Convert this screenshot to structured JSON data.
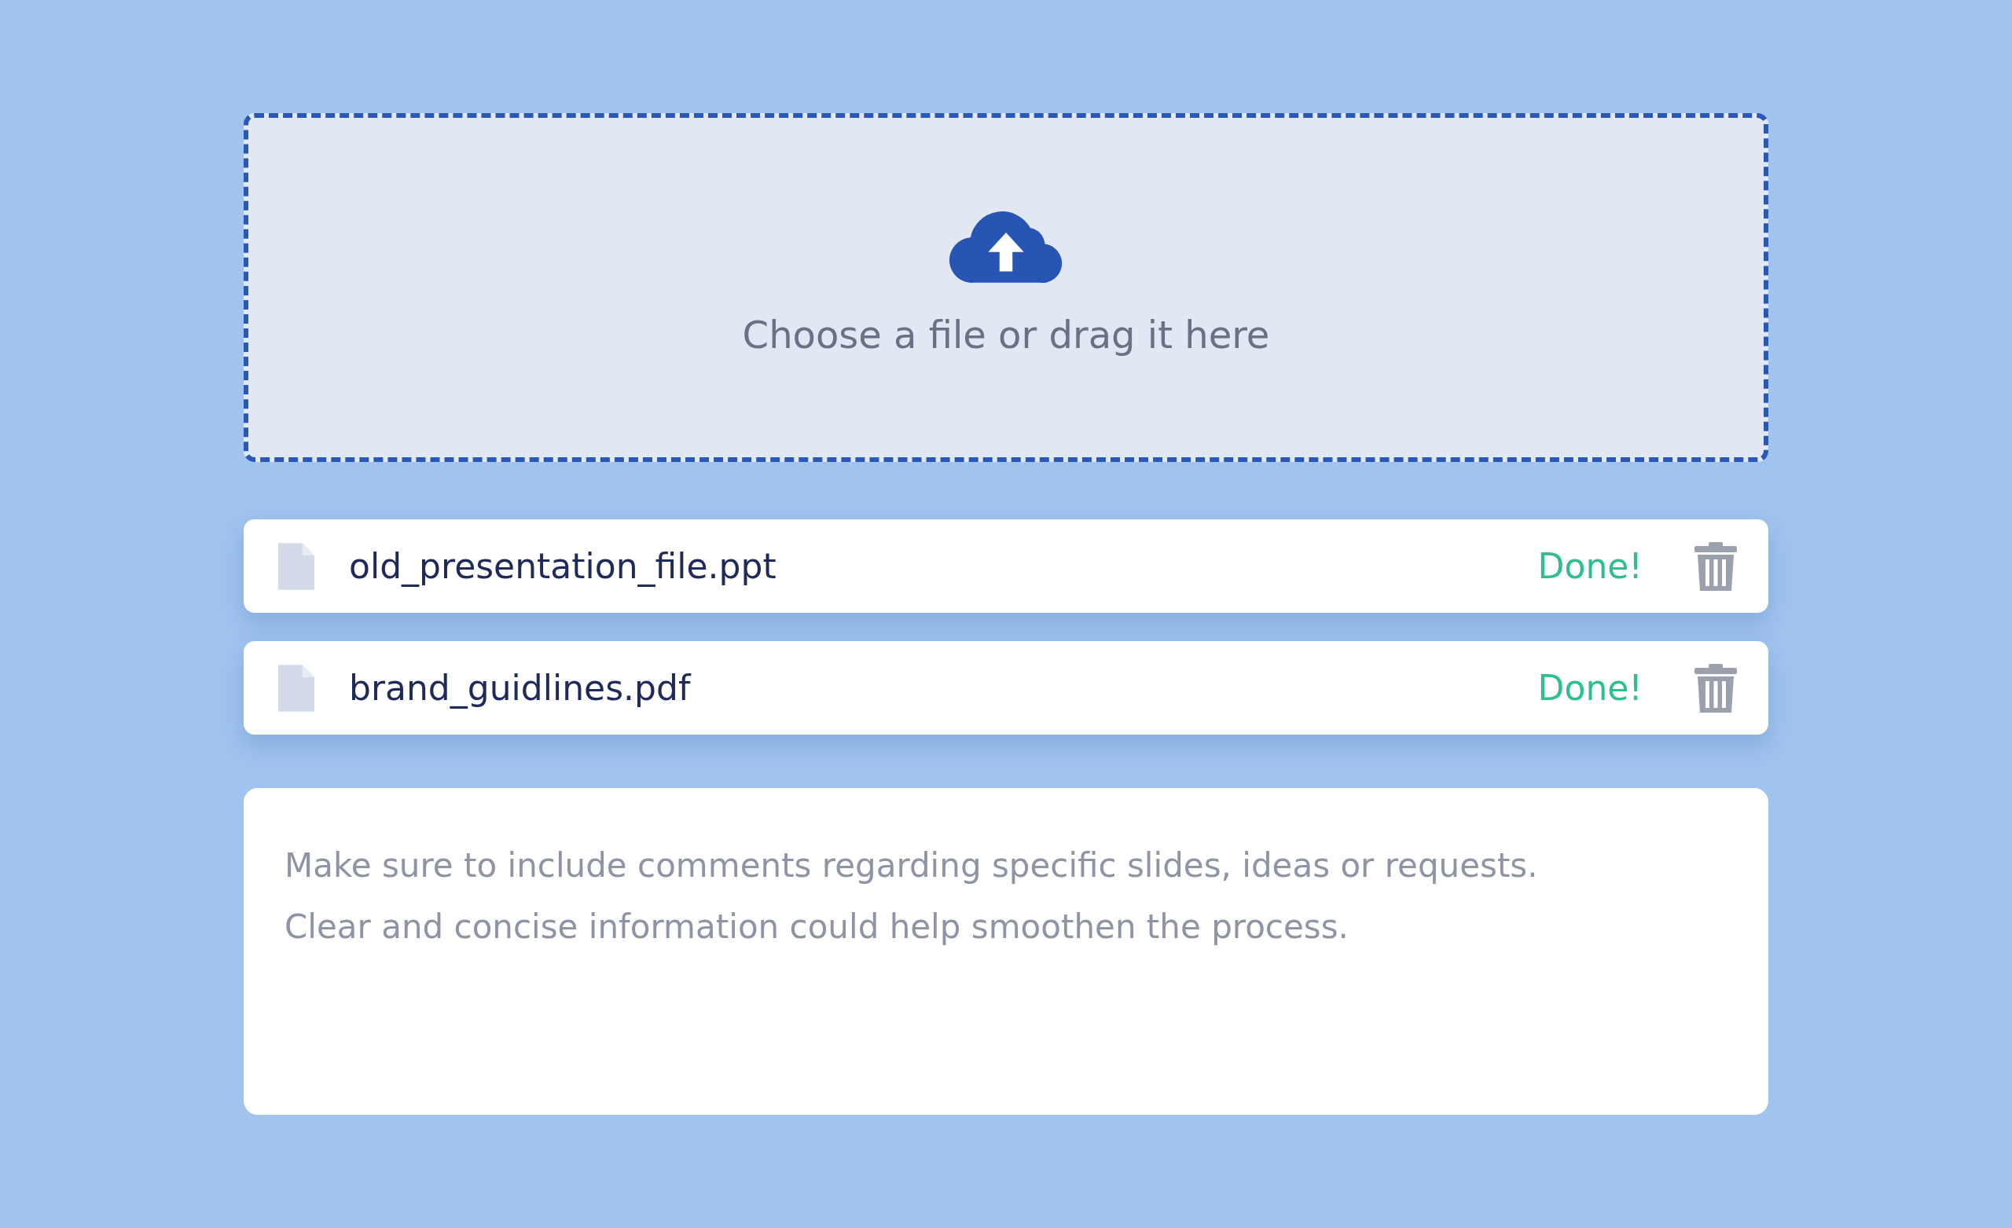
{
  "dropzone": {
    "label": "Choose a file or drag it here"
  },
  "files": [
    {
      "name": "old_presentation_file.ppt",
      "status": "Done!"
    },
    {
      "name": "brand_guidlines.pdf",
      "status": "Done!"
    }
  ],
  "comments": {
    "placeholder": "Make sure to include comments regarding specific slides, ideas or requests.\nClear and concise information could help smoothen the process."
  }
}
